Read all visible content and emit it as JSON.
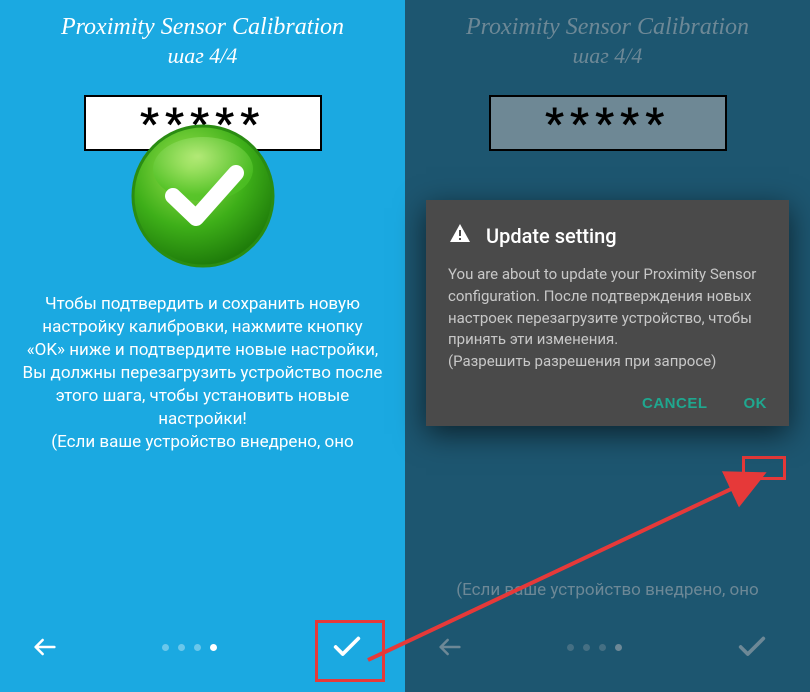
{
  "left": {
    "title": "Proximity Sensor Calibration",
    "step": "шаг 4/4",
    "password": "*****",
    "instruction": "Чтобы подтвердить и сохранить новую настройку калибровки, нажмите кнопку «OK» ниже и подтвердите новые настройки,\nВы должны перезагрузить устройство после этого шага, чтобы установить новые настройки!\n(Если ваше устройство внедрено, оно"
  },
  "right": {
    "title": "Proximity Sensor Calibration",
    "step": "шаг 4/4",
    "password": "*****",
    "instruction": "(Если ваше устройство внедрено, оно"
  },
  "dialog": {
    "title": "Update setting",
    "body": "You are about to update your Proximity Sensor configuration. После подтверждения новых настроек перезагрузите устройство, чтобы принять эти изменения.\n (Разрешить разрешения при запросе)",
    "cancel": "CANCEL",
    "ok": "OK"
  }
}
